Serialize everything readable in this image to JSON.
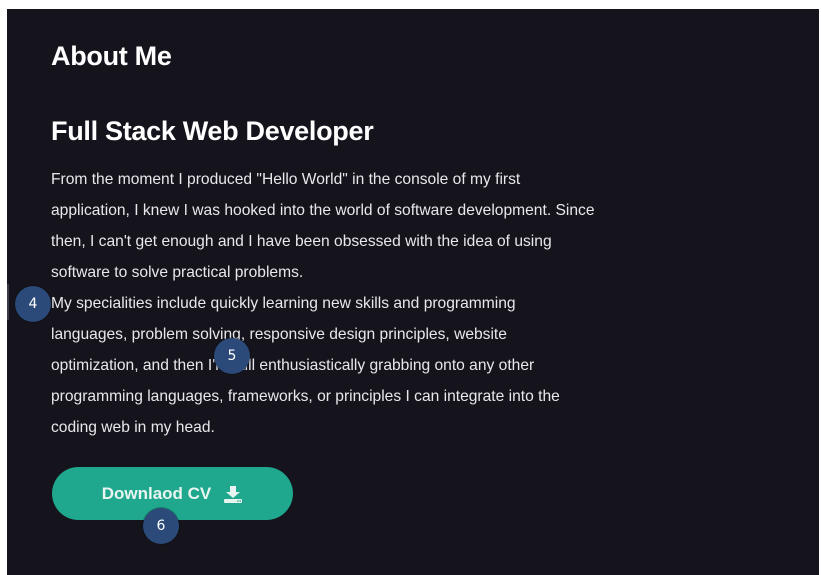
{
  "about": {
    "section_title": "About Me",
    "role_title": "Full Stack Web Developer",
    "bio_lines": [
      "From the moment I produced \"Hello World\" in the console of my first",
      "application, I knew I was hooked into the world of software development. Since",
      "then, I can't get enough and I have been obsessed with the idea of using",
      "software to solve practical problems.",
      "My specialities include quickly learning new skills and programming",
      "languages, problem solving, responsive design principles, website",
      "optimization, and then I'm still enthusiastically grabbing onto any other",
      "programming languages, frameworks, or principles I can integrate into the",
      "coding web in my head."
    ],
    "cv_button": {
      "label": "Downlaod CV",
      "icon": "download-icon"
    }
  },
  "markers": [
    "4",
    "5",
    "6"
  ],
  "colors": {
    "panel_background": "#15141c",
    "accent": "#1fa88d",
    "marker": "#2b4a7a"
  }
}
